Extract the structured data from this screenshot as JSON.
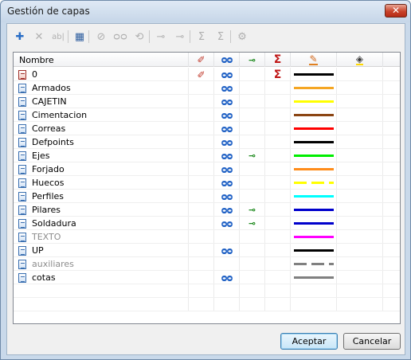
{
  "window": {
    "title": "Gestión de capas"
  },
  "toolbar": {
    "buttons": [
      {
        "name": "new-layer-button",
        "icon": "new-layer-icon",
        "glyph": "✚",
        "enabled": true
      },
      {
        "name": "delete-layer-button",
        "icon": "delete-icon",
        "glyph": "✕",
        "enabled": false
      },
      {
        "name": "rename-layer-button",
        "icon": "rename-icon",
        "glyph": "ab|",
        "enabled": false
      },
      {
        "name": "select-layer-button",
        "icon": "select-objects-icon",
        "glyph": "▦",
        "enabled": true
      },
      {
        "name": "hide-layer-button",
        "icon": "eye-off-icon",
        "glyph": "⊘",
        "enabled": false
      },
      {
        "name": "show-layer-button",
        "icon": "glasses-icon",
        "glyph": "ᴑᴑ",
        "enabled": false
      },
      {
        "name": "refresh-button",
        "icon": "refresh-icon",
        "glyph": "⟲",
        "enabled": false
      },
      {
        "name": "lock-button",
        "icon": "key-icon",
        "glyph": "⊸",
        "enabled": false
      },
      {
        "name": "unlock-button",
        "icon": "key-check-icon",
        "glyph": "⊸",
        "enabled": false
      },
      {
        "name": "sum-button",
        "icon": "sigma-icon",
        "glyph": "Σ",
        "enabled": false
      },
      {
        "name": "sum-off-button",
        "icon": "sigma-slash-icon",
        "glyph": "Σ",
        "enabled": false
      },
      {
        "name": "settings-button",
        "icon": "gear-icon",
        "glyph": "⚙",
        "enabled": false
      }
    ]
  },
  "columns": {
    "name": "Nombre",
    "visible_icon": "eye-off-icon",
    "view_icon": "glasses-icon",
    "lock_icon": "key-icon",
    "sum_icon": "sigma-icon",
    "color_icon": "pen-color-icon",
    "fill_icon": "paint-bucket-icon"
  },
  "layers": [
    {
      "name": "0",
      "icon": "red",
      "hidden": true,
      "glasses": true,
      "key": false,
      "sigma": true,
      "color": "#000000",
      "style": "solid",
      "dim": false
    },
    {
      "name": "Armados",
      "icon": "blue",
      "hidden": false,
      "glasses": true,
      "key": false,
      "sigma": false,
      "color": "#f5a623",
      "style": "solid",
      "dim": false
    },
    {
      "name": "CAJETIN",
      "icon": "blue",
      "hidden": false,
      "glasses": true,
      "key": false,
      "sigma": false,
      "color": "#ffff00",
      "style": "solid",
      "dim": false
    },
    {
      "name": "Cimentacion",
      "icon": "blue",
      "hidden": false,
      "glasses": true,
      "key": false,
      "sigma": false,
      "color": "#8b4513",
      "style": "solid",
      "dim": false
    },
    {
      "name": "Correas",
      "icon": "blue",
      "hidden": false,
      "glasses": true,
      "key": false,
      "sigma": false,
      "color": "#ff0000",
      "style": "solid",
      "dim": false
    },
    {
      "name": "Defpoints",
      "icon": "blue",
      "hidden": false,
      "glasses": true,
      "key": false,
      "sigma": false,
      "color": "#000000",
      "style": "solid",
      "dim": false
    },
    {
      "name": "Ejes",
      "icon": "blue",
      "hidden": false,
      "glasses": true,
      "key": true,
      "sigma": false,
      "color": "#00ee00",
      "style": "solid",
      "dim": false
    },
    {
      "name": "Forjado",
      "icon": "blue",
      "hidden": false,
      "glasses": true,
      "key": false,
      "sigma": false,
      "color": "#ff8c1a",
      "style": "solid",
      "dim": false
    },
    {
      "name": "Huecos",
      "icon": "blue",
      "hidden": false,
      "glasses": true,
      "key": false,
      "sigma": false,
      "color": "#ffff00",
      "style": "dashed",
      "dim": false
    },
    {
      "name": "Perfiles",
      "icon": "blue",
      "hidden": false,
      "glasses": true,
      "key": false,
      "sigma": false,
      "color": "#00ffff",
      "style": "solid",
      "dim": false
    },
    {
      "name": "Pilares",
      "icon": "blue",
      "hidden": false,
      "glasses": true,
      "key": true,
      "sigma": false,
      "color": "#0000cc",
      "style": "solid",
      "dim": false
    },
    {
      "name": "Soldadura",
      "icon": "blue",
      "hidden": false,
      "glasses": true,
      "key": true,
      "sigma": false,
      "color": "#0000cc",
      "style": "solid",
      "dim": false
    },
    {
      "name": "TEXTO",
      "icon": "blue",
      "hidden": false,
      "glasses": false,
      "key": false,
      "sigma": false,
      "color": "#ff00ff",
      "style": "solid",
      "dim": true
    },
    {
      "name": "UP",
      "icon": "blue",
      "hidden": false,
      "glasses": true,
      "key": false,
      "sigma": false,
      "color": "#000000",
      "style": "solid",
      "dim": false
    },
    {
      "name": "auxiliares",
      "icon": "blue",
      "hidden": false,
      "glasses": false,
      "key": false,
      "sigma": false,
      "color": "#808080",
      "style": "dashed",
      "dim": true
    },
    {
      "name": "cotas",
      "icon": "blue",
      "hidden": false,
      "glasses": true,
      "key": false,
      "sigma": false,
      "color": "#808080",
      "style": "solid",
      "dim": false
    }
  ],
  "buttons": {
    "accept": "Aceptar",
    "cancel": "Cancelar"
  },
  "colors": {
    "dim_text": "#8c8c8c",
    "accent": "#3c7fb1"
  }
}
